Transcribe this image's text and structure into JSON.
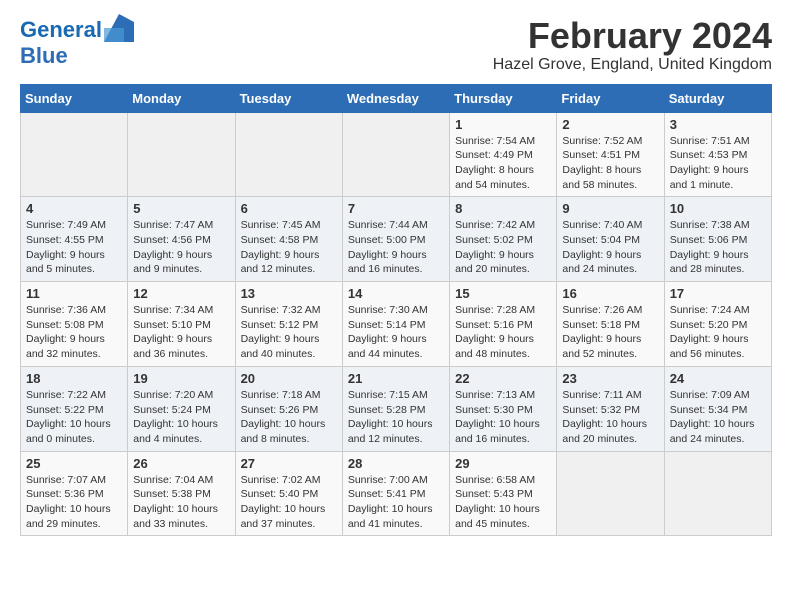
{
  "header": {
    "logo_line1": "General",
    "logo_line2": "Blue",
    "title": "February 2024",
    "subtitle": "Hazel Grove, England, United Kingdom"
  },
  "calendar": {
    "days_of_week": [
      "Sunday",
      "Monday",
      "Tuesday",
      "Wednesday",
      "Thursday",
      "Friday",
      "Saturday"
    ],
    "weeks": [
      [
        {
          "day": "",
          "detail": ""
        },
        {
          "day": "",
          "detail": ""
        },
        {
          "day": "",
          "detail": ""
        },
        {
          "day": "",
          "detail": ""
        },
        {
          "day": "1",
          "detail": "Sunrise: 7:54 AM\nSunset: 4:49 PM\nDaylight: 8 hours and 54 minutes."
        },
        {
          "day": "2",
          "detail": "Sunrise: 7:52 AM\nSunset: 4:51 PM\nDaylight: 8 hours and 58 minutes."
        },
        {
          "day": "3",
          "detail": "Sunrise: 7:51 AM\nSunset: 4:53 PM\nDaylight: 9 hours and 1 minute."
        }
      ],
      [
        {
          "day": "4",
          "detail": "Sunrise: 7:49 AM\nSunset: 4:55 PM\nDaylight: 9 hours and 5 minutes."
        },
        {
          "day": "5",
          "detail": "Sunrise: 7:47 AM\nSunset: 4:56 PM\nDaylight: 9 hours and 9 minutes."
        },
        {
          "day": "6",
          "detail": "Sunrise: 7:45 AM\nSunset: 4:58 PM\nDaylight: 9 hours and 12 minutes."
        },
        {
          "day": "7",
          "detail": "Sunrise: 7:44 AM\nSunset: 5:00 PM\nDaylight: 9 hours and 16 minutes."
        },
        {
          "day": "8",
          "detail": "Sunrise: 7:42 AM\nSunset: 5:02 PM\nDaylight: 9 hours and 20 minutes."
        },
        {
          "day": "9",
          "detail": "Sunrise: 7:40 AM\nSunset: 5:04 PM\nDaylight: 9 hours and 24 minutes."
        },
        {
          "day": "10",
          "detail": "Sunrise: 7:38 AM\nSunset: 5:06 PM\nDaylight: 9 hours and 28 minutes."
        }
      ],
      [
        {
          "day": "11",
          "detail": "Sunrise: 7:36 AM\nSunset: 5:08 PM\nDaylight: 9 hours and 32 minutes."
        },
        {
          "day": "12",
          "detail": "Sunrise: 7:34 AM\nSunset: 5:10 PM\nDaylight: 9 hours and 36 minutes."
        },
        {
          "day": "13",
          "detail": "Sunrise: 7:32 AM\nSunset: 5:12 PM\nDaylight: 9 hours and 40 minutes."
        },
        {
          "day": "14",
          "detail": "Sunrise: 7:30 AM\nSunset: 5:14 PM\nDaylight: 9 hours and 44 minutes."
        },
        {
          "day": "15",
          "detail": "Sunrise: 7:28 AM\nSunset: 5:16 PM\nDaylight: 9 hours and 48 minutes."
        },
        {
          "day": "16",
          "detail": "Sunrise: 7:26 AM\nSunset: 5:18 PM\nDaylight: 9 hours and 52 minutes."
        },
        {
          "day": "17",
          "detail": "Sunrise: 7:24 AM\nSunset: 5:20 PM\nDaylight: 9 hours and 56 minutes."
        }
      ],
      [
        {
          "day": "18",
          "detail": "Sunrise: 7:22 AM\nSunset: 5:22 PM\nDaylight: 10 hours and 0 minutes."
        },
        {
          "day": "19",
          "detail": "Sunrise: 7:20 AM\nSunset: 5:24 PM\nDaylight: 10 hours and 4 minutes."
        },
        {
          "day": "20",
          "detail": "Sunrise: 7:18 AM\nSunset: 5:26 PM\nDaylight: 10 hours and 8 minutes."
        },
        {
          "day": "21",
          "detail": "Sunrise: 7:15 AM\nSunset: 5:28 PM\nDaylight: 10 hours and 12 minutes."
        },
        {
          "day": "22",
          "detail": "Sunrise: 7:13 AM\nSunset: 5:30 PM\nDaylight: 10 hours and 16 minutes."
        },
        {
          "day": "23",
          "detail": "Sunrise: 7:11 AM\nSunset: 5:32 PM\nDaylight: 10 hours and 20 minutes."
        },
        {
          "day": "24",
          "detail": "Sunrise: 7:09 AM\nSunset: 5:34 PM\nDaylight: 10 hours and 24 minutes."
        }
      ],
      [
        {
          "day": "25",
          "detail": "Sunrise: 7:07 AM\nSunset: 5:36 PM\nDaylight: 10 hours and 29 minutes."
        },
        {
          "day": "26",
          "detail": "Sunrise: 7:04 AM\nSunset: 5:38 PM\nDaylight: 10 hours and 33 minutes."
        },
        {
          "day": "27",
          "detail": "Sunrise: 7:02 AM\nSunset: 5:40 PM\nDaylight: 10 hours and 37 minutes."
        },
        {
          "day": "28",
          "detail": "Sunrise: 7:00 AM\nSunset: 5:41 PM\nDaylight: 10 hours and 41 minutes."
        },
        {
          "day": "29",
          "detail": "Sunrise: 6:58 AM\nSunset: 5:43 PM\nDaylight: 10 hours and 45 minutes."
        },
        {
          "day": "",
          "detail": ""
        },
        {
          "day": "",
          "detail": ""
        }
      ]
    ]
  }
}
